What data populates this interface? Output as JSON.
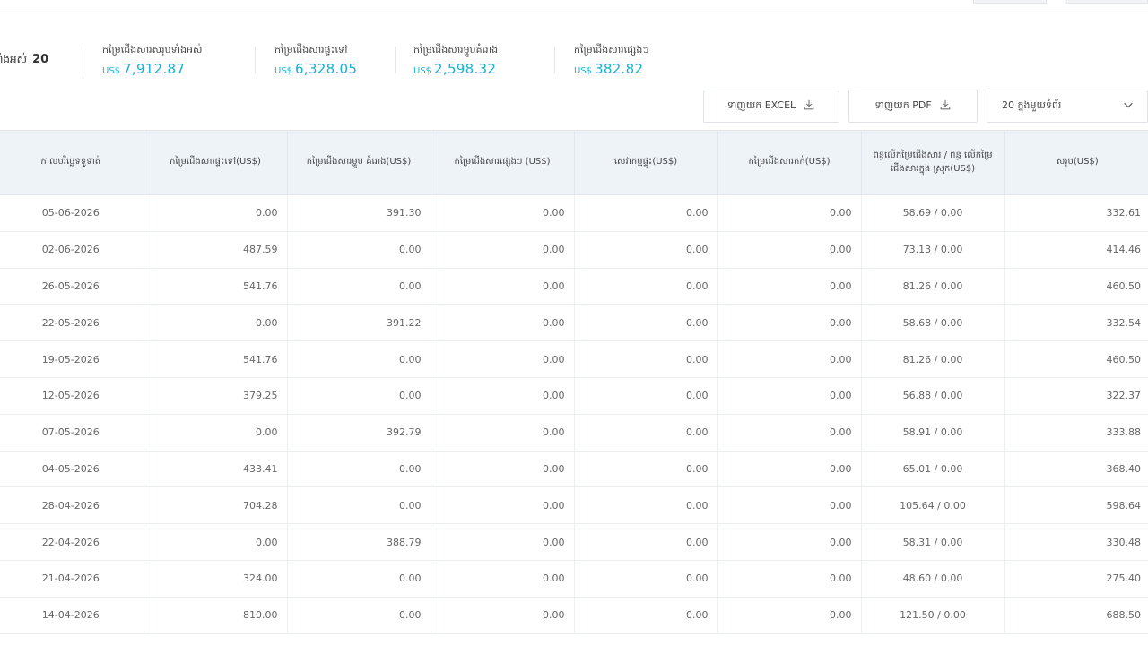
{
  "summary": {
    "total_label": "ទាំងអស់",
    "total_count": "20",
    "currency": "US$",
    "items": [
      {
        "label": "កម្រៃជើងសារសរុបទាំងអស់",
        "amount": "7,912.87"
      },
      {
        "label": "កម្រៃជើងសារផ្ទះទៅ",
        "amount": "6,328.05"
      },
      {
        "label": "កម្រៃជើងសារម្ហូបគំរោង",
        "amount": "2,598.32"
      },
      {
        "label": "កម្រៃជើងសារផ្សេងៗ",
        "amount": "382.82"
      }
    ]
  },
  "toolbar": {
    "export_excel_label": "ទាញយក EXCEL",
    "export_pdf_label": "ទាញយក PDF",
    "page_size_label": "20 ក្នុងមួយទំព័រ"
  },
  "icons": {
    "download": "download-icon",
    "dropdown": "chevron-down-icon"
  },
  "colors": {
    "accent": "#13b3d4",
    "header_bg": "#eef3f8"
  },
  "table": {
    "columns": [
      "កាលបរិច្ឆេទទូទាត់",
      "កម្រៃជើងសារផ្ទះទៅ(US$)",
      "កម្រៃជើងសារម្ហូប គំរោង(US$)",
      "កម្រៃជើងសារផ្សេងៗ (US$)",
      "សេវាកម្មផ្ទុះ(US$)",
      "កម្រៃជើងសារកក់(US$)",
      "ពន្ធលើកម្រៃជើងសារ / ពន្ធ លើកម្រៃជើងសារក្នុង ស្រុក(US$)",
      "សរុប(US$)"
    ],
    "rows": [
      [
        "05-06-2026",
        "0.00",
        "391.30",
        "0.00",
        "0.00",
        "0.00",
        "58.69 / 0.00",
        "332.61"
      ],
      [
        "02-06-2026",
        "487.59",
        "0.00",
        "0.00",
        "0.00",
        "0.00",
        "73.13 / 0.00",
        "414.46"
      ],
      [
        "26-05-2026",
        "541.76",
        "0.00",
        "0.00",
        "0.00",
        "0.00",
        "81.26 / 0.00",
        "460.50"
      ],
      [
        "22-05-2026",
        "0.00",
        "391.22",
        "0.00",
        "0.00",
        "0.00",
        "58.68 / 0.00",
        "332.54"
      ],
      [
        "19-05-2026",
        "541.76",
        "0.00",
        "0.00",
        "0.00",
        "0.00",
        "81.26 / 0.00",
        "460.50"
      ],
      [
        "12-05-2026",
        "379.25",
        "0.00",
        "0.00",
        "0.00",
        "0.00",
        "56.88 / 0.00",
        "322.37"
      ],
      [
        "07-05-2026",
        "0.00",
        "392.79",
        "0.00",
        "0.00",
        "0.00",
        "58.91 / 0.00",
        "333.88"
      ],
      [
        "04-05-2026",
        "433.41",
        "0.00",
        "0.00",
        "0.00",
        "0.00",
        "65.01 / 0.00",
        "368.40"
      ],
      [
        "28-04-2026",
        "704.28",
        "0.00",
        "0.00",
        "0.00",
        "0.00",
        "105.64 / 0.00",
        "598.64"
      ],
      [
        "22-04-2026",
        "0.00",
        "388.79",
        "0.00",
        "0.00",
        "0.00",
        "58.31 / 0.00",
        "330.48"
      ],
      [
        "21-04-2026",
        "324.00",
        "0.00",
        "0.00",
        "0.00",
        "0.00",
        "48.60 / 0.00",
        "275.40"
      ],
      [
        "14-04-2026",
        "810.00",
        "0.00",
        "0.00",
        "0.00",
        "0.00",
        "121.50 / 0.00",
        "688.50"
      ]
    ]
  }
}
